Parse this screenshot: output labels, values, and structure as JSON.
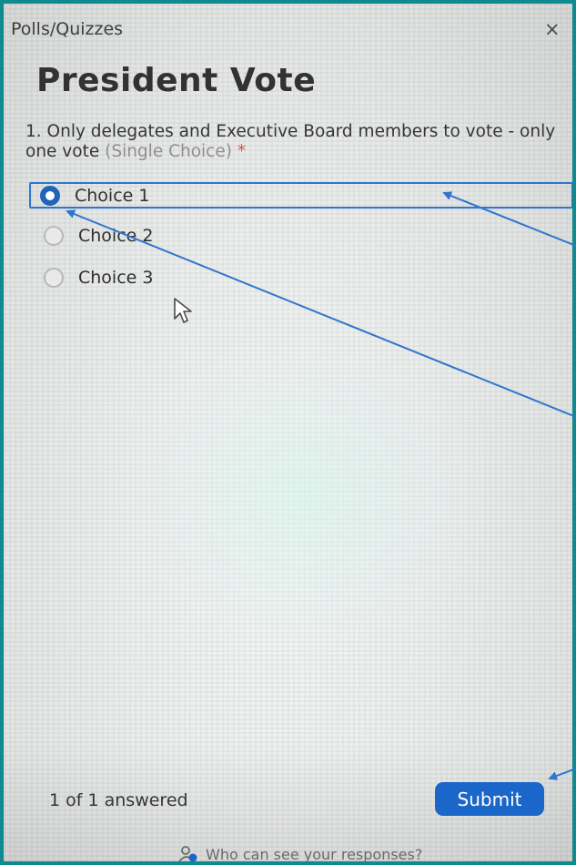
{
  "header": {
    "title": "Polls/Quizzes",
    "close_label": "×"
  },
  "poll": {
    "title": "President Vote",
    "question": {
      "number_text": "1. Only delegates and Executive Board members to vote - only one vote",
      "type_label": "(Single Choice)",
      "required_mark": "*"
    },
    "options": [
      {
        "label": "Choice 1",
        "selected": true
      },
      {
        "label": "Choice 2",
        "selected": false
      },
      {
        "label": "Choice 3",
        "selected": false
      }
    ]
  },
  "footer": {
    "answered_text": "1 of 1 answered",
    "submit_label": "Submit",
    "privacy_link": "Who can see your responses?"
  },
  "colors": {
    "accent": "#1b66c9",
    "annotation": "#2f76cc",
    "required": "#d9534f",
    "frame": "#0f8a8e"
  }
}
